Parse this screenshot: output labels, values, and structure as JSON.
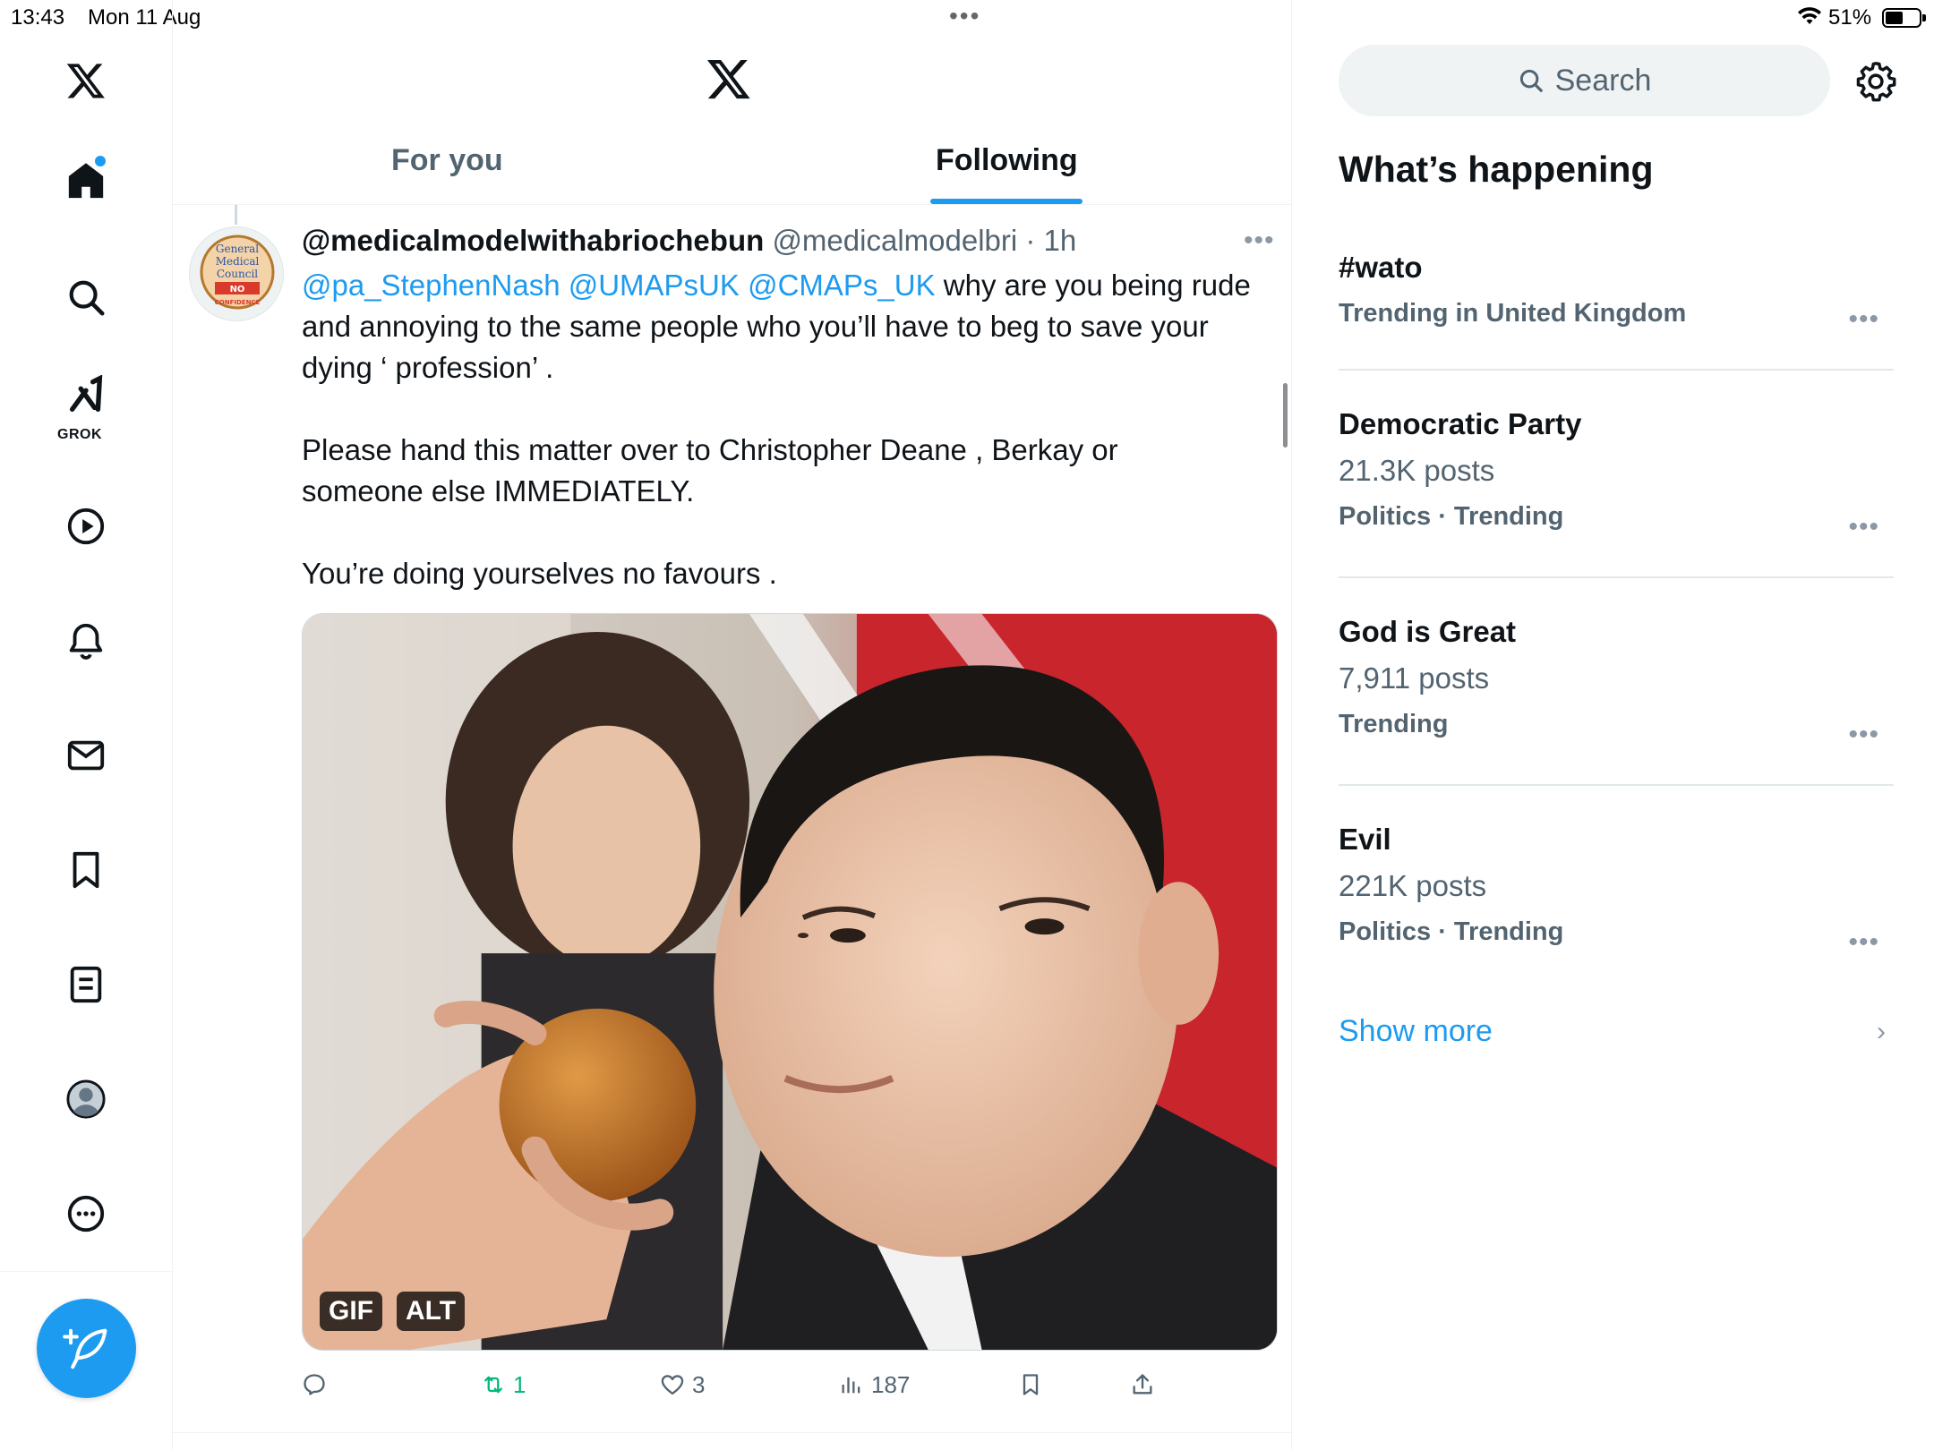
{
  "status_bar": {
    "time": "13:43",
    "date": "Mon 11 Aug",
    "battery_pct": "51%",
    "battery_level": 0.51
  },
  "nav": {
    "items": [
      "home-icon",
      "search-icon",
      "grok-icon",
      "video-icon",
      "notifications-icon",
      "messages-icon",
      "bookmarks-icon",
      "lists-icon",
      "profile-icon",
      "more-icon"
    ],
    "grok_label": "GROK",
    "has_home_notification": true
  },
  "timeline": {
    "tabs": [
      {
        "label": "For you",
        "active": false
      },
      {
        "label": "Following",
        "active": true
      }
    ]
  },
  "tweet": {
    "name": "@medicalmodelwithabriochebun",
    "handle": "@medicalmodelbri",
    "sep": " · ",
    "time": "1h",
    "mentions": [
      "@pa_StephenNash",
      "@UMAPsUK",
      "@CMAPs_UK"
    ],
    "text_line1_rest": " why are you being rude",
    "text_line2": "and annoying to the same people who you’ll have to beg to save your",
    "text_line3": "dying ‘ profession’ .",
    "text_para2_line1": "Please hand this matter over to Christopher Deane , Berkay or",
    "text_para2_line2": "someone else IMMEDIATELY.",
    "text_para3": "You’re doing yourselves no favours .",
    "media_badges": [
      "GIF",
      "ALT"
    ],
    "stats": {
      "replies": "",
      "reposts": "1",
      "likes": "3",
      "views": "187"
    },
    "avatar_text": [
      "General",
      "Medical",
      "Council",
      "NO",
      "CONFIDENCE"
    ]
  },
  "sidebar": {
    "search_placeholder": "Search",
    "section_title": "What’s happening",
    "trends": [
      {
        "name": "#wato",
        "posts": "",
        "context": "Trending in United Kingdom"
      },
      {
        "name": "Democratic Party",
        "posts": "21.3K posts",
        "context": "Politics · Trending"
      },
      {
        "name": "God is Great",
        "posts": "7,911 posts",
        "context": "Trending"
      },
      {
        "name": "Evil",
        "posts": "221K posts",
        "context": "Politics · Trending"
      }
    ],
    "show_more": "Show more"
  },
  "colors": {
    "accent": "#1d9bf0",
    "text_primary": "#0f1419",
    "text_secondary": "#536471",
    "repost_green": "#00ba7c"
  }
}
